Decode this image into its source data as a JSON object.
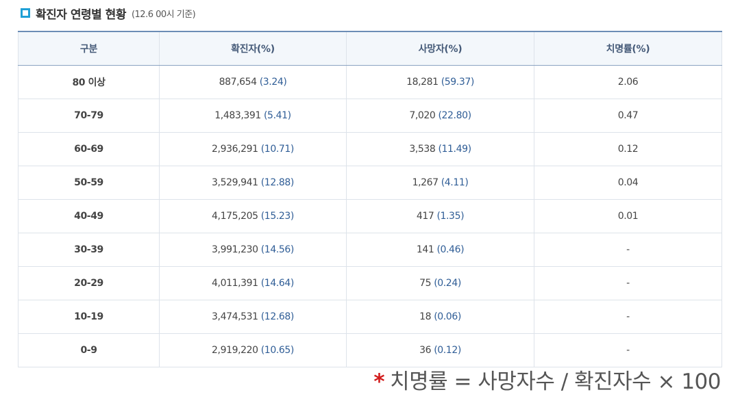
{
  "title": "확진자 연령별 현황",
  "title_note": "(12.6 00시 기준)",
  "headers": [
    "구분",
    "확진자(%)",
    "사망자(%)",
    "치명률(%)"
  ],
  "rows": [
    {
      "age": "80 이상",
      "cases": "887,654",
      "cases_pct": "(3.24)",
      "deaths": "18,281",
      "deaths_pct": "(59.37)",
      "fatality": "2.06"
    },
    {
      "age": "70-79",
      "cases": "1,483,391",
      "cases_pct": "(5.41)",
      "deaths": "7,020",
      "deaths_pct": "(22.80)",
      "fatality": "0.47"
    },
    {
      "age": "60-69",
      "cases": "2,936,291",
      "cases_pct": "(10.71)",
      "deaths": "3,538",
      "deaths_pct": "(11.49)",
      "fatality": "0.12"
    },
    {
      "age": "50-59",
      "cases": "3,529,941",
      "cases_pct": "(12.88)",
      "deaths": "1,267",
      "deaths_pct": "(4.11)",
      "fatality": "0.04"
    },
    {
      "age": "40-49",
      "cases": "4,175,205",
      "cases_pct": "(15.23)",
      "deaths": "417",
      "deaths_pct": "(1.35)",
      "fatality": "0.01"
    },
    {
      "age": "30-39",
      "cases": "3,991,230",
      "cases_pct": "(14.56)",
      "deaths": "141",
      "deaths_pct": "(0.46)",
      "fatality": "-"
    },
    {
      "age": "20-29",
      "cases": "4,011,391",
      "cases_pct": "(14.64)",
      "deaths": "75",
      "deaths_pct": "(0.24)",
      "fatality": "-"
    },
    {
      "age": "10-19",
      "cases": "3,474,531",
      "cases_pct": "(12.68)",
      "deaths": "18",
      "deaths_pct": "(0.06)",
      "fatality": "-"
    },
    {
      "age": "0-9",
      "cases": "2,919,220",
      "cases_pct": "(10.65)",
      "deaths": "36",
      "deaths_pct": "(0.12)",
      "fatality": "-"
    }
  ],
  "formula": {
    "star": "*",
    "text": "치명률 = 사망자수 / 확진자수 × 100"
  },
  "colors": {
    "accent": "#1fa0d6",
    "header_text": "#455a78",
    "pct_text": "#2f5d96",
    "star": "#d21c1c"
  },
  "icons": {
    "title_marker": "square-bullet-icon"
  }
}
